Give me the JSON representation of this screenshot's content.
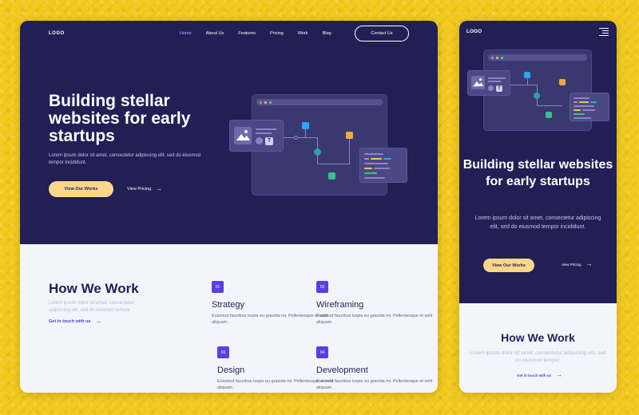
{
  "desktop": {
    "nav": {
      "logo": "LOGO",
      "links": [
        "Home",
        "About Us",
        "Features",
        "Pricing",
        "Work",
        "Blog"
      ],
      "active_link": "Home",
      "contact_label": "Contact Us"
    },
    "hero": {
      "title": "Building stellar websites for early startups",
      "description": "Lorem ipsum dolor sit amet, consectetur adipiscing elit, sed do eiusmod tempor incididunt.",
      "primary_cta": "View Our Works",
      "secondary_cta": "View Pricing"
    },
    "how_we_work": {
      "title": "How We Work",
      "description": "Lorem ipsum dolor sit amet, consectetur adipiscing elit, sed do eiusmod tempor.",
      "link": "Get in touch with us",
      "steps": [
        {
          "number": "01",
          "title": "Strategy",
          "description": "Euismod faucibus turpis eu gravida mi. Pellentesque et velit aliquam ."
        },
        {
          "number": "02",
          "title": "Wireframing",
          "description": "Euismod faucibus turpis eu gravida mi. Pellentesque et velit aliquam ."
        },
        {
          "number": "03",
          "title": "Design",
          "description": "Euismod faucibus turpis eu gravida mi. Pellentesque et velit aliquam ."
        },
        {
          "number": "04",
          "title": "Development",
          "description": "Euismod faucibus turpis eu gravida mi. Pellentesque et velit aliquam ."
        }
      ]
    }
  },
  "mobile": {
    "logo": "LOGO",
    "hero": {
      "title": "Building stellar websites for early startups",
      "description": "Lorem ipsum dolor sit amet, consectetur adipiscing elit, sed do eiusmod tempor incididunt.",
      "primary_cta": "View Our Works",
      "secondary_cta": "View Pricing"
    },
    "how_we_work": {
      "title": "How We Work",
      "description": "Lorem ipsum dolor sit amet, consectetur adipiscing elit, sed do eiusmod tempor.",
      "link": "Get in touch with us"
    }
  },
  "icons": {
    "menu": "hamburger-menu-icon",
    "arrow": "arrow-right-icon",
    "image": "image-icon",
    "text": "text-icon",
    "code": "code-braces-icon"
  },
  "colors": {
    "hero_bg": "#211f54",
    "accent_yellow": "#fbd68a",
    "accent_purple": "#5a3fe0",
    "link_blue": "#4b3fd6",
    "page_bg": "#f2c91d"
  }
}
